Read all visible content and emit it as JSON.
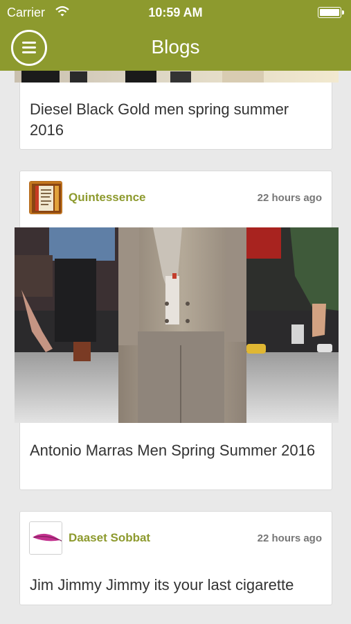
{
  "status_bar": {
    "carrier": "Carrier",
    "time": "10:59 AM"
  },
  "nav": {
    "title": "Blogs"
  },
  "posts": [
    {
      "title": "Diesel Black Gold men spring summer 2016"
    },
    {
      "author": "Quintessence",
      "time": "22 hours ago",
      "title": "Antonio Marras Men Spring Summer 2016",
      "avatar_icon": "book-avatar-icon"
    },
    {
      "author": "Daaset Sobbat",
      "time": "22 hours ago",
      "title": "Jim Jimmy Jimmy its your last cigarette",
      "avatar_icon": "feather-avatar-icon"
    }
  ],
  "colors": {
    "header": "#8d9a2e",
    "author": "#8d9a2e",
    "background": "#e9e9e9"
  }
}
